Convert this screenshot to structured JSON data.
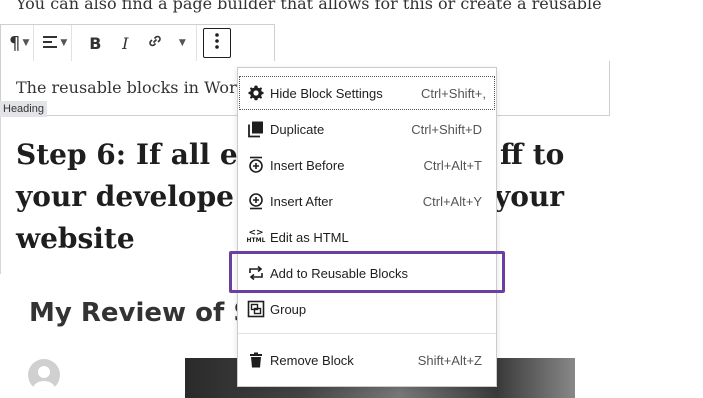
{
  "editor": {
    "top_text": "You can also find a page builder that allows for this or create a reusable",
    "paragraph_text": "The reusable blocks in WordI",
    "heading_badge": "Heading",
    "heading_text": "Step 6: If all el            ff to your develope           your website",
    "heading_line1": "Step 6: If all el",
    "heading_line1_right": "ff to",
    "heading_line2": "your develope",
    "heading_line2_right": "your",
    "heading_line3": "website",
    "review_title": "My Review of S"
  },
  "toolbar": {
    "paragraph_icon": "pilcrow-icon",
    "align_icon": "align-left-icon",
    "bold_label": "B",
    "italic_label": "I",
    "link_icon": "link-icon",
    "more_icon": "vertical-ellipsis-icon"
  },
  "menu": {
    "items": [
      {
        "label": "Hide Block Settings",
        "shortcut": "Ctrl+Shift+,",
        "icon": "gear-icon"
      },
      {
        "label": "Duplicate",
        "shortcut": "Ctrl+Shift+D",
        "icon": "duplicate-icon"
      },
      {
        "label": "Insert Before",
        "shortcut": "Ctrl+Alt+T",
        "icon": "insert-before-icon"
      },
      {
        "label": "Insert After",
        "shortcut": "Ctrl+Alt+Y",
        "icon": "insert-after-icon"
      },
      {
        "label": "Edit as HTML",
        "shortcut": "",
        "icon": "html-icon"
      },
      {
        "label": "Add to Reusable Blocks",
        "shortcut": "",
        "icon": "reusable-block-icon"
      },
      {
        "label": "Group",
        "shortcut": "",
        "icon": "group-icon"
      },
      {
        "label": "Remove Block",
        "shortcut": "Shift+Alt+Z",
        "icon": "trash-icon"
      }
    ],
    "html_icon_text": "HTML"
  },
  "colors": {
    "highlight": "#6b3fa0"
  }
}
